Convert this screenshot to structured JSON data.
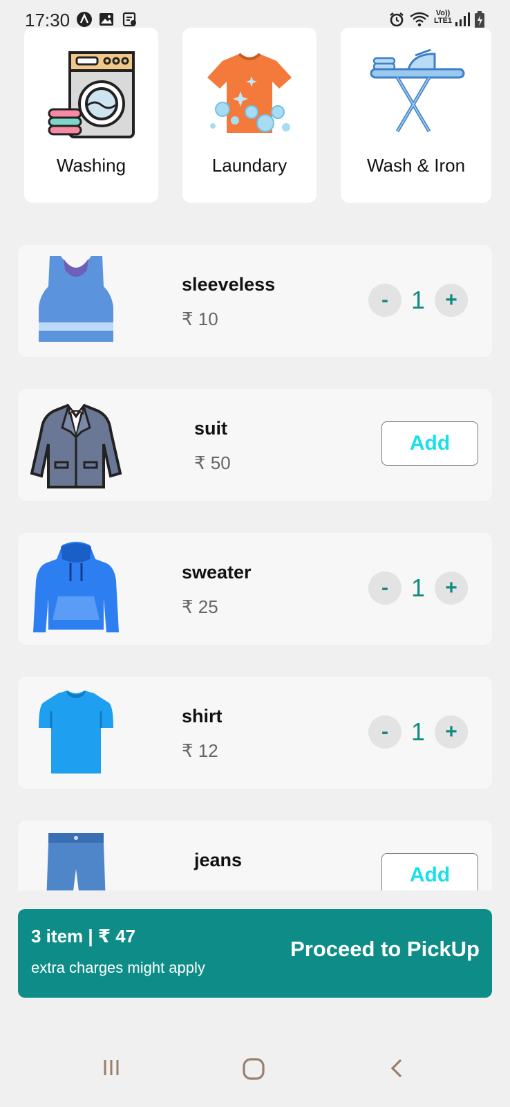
{
  "status_bar": {
    "time": "17:30",
    "left_icons": [
      "a-circle-icon",
      "image-icon",
      "clipboard-icon"
    ],
    "right_icons": [
      "alarm-icon",
      "wifi-icon",
      "volte-icon",
      "signal-icon",
      "battery-icon"
    ],
    "volte_text": "Vo)) LTE1"
  },
  "services": [
    {
      "label": "Washing",
      "icon": "washing-machine-icon"
    },
    {
      "label": "Laundary",
      "icon": "tshirt-bubbles-icon"
    },
    {
      "label": "Wash & Iron",
      "icon": "ironing-board-icon"
    }
  ],
  "items": [
    {
      "name": "sleeveless",
      "price": "₹ 10",
      "quantity": "1",
      "icon": "tank-top-icon",
      "minus": "-",
      "plus": "+"
    },
    {
      "name": "suit",
      "price": "₹ 50",
      "add_label": "Add",
      "icon": "suit-icon"
    },
    {
      "name": "sweater",
      "price": "₹ 25",
      "quantity": "1",
      "icon": "hoodie-icon",
      "minus": "-",
      "plus": "+"
    },
    {
      "name": "shirt",
      "price": "₹ 12",
      "quantity": "1",
      "icon": "tshirt-icon",
      "minus": "-",
      "plus": "+"
    },
    {
      "name": "jeans",
      "add_label": "Add",
      "icon": "jeans-icon"
    }
  ],
  "cart": {
    "summary": "3 item | ₹ 47",
    "note": "extra charges might apply",
    "proceed_label": "Proceed to PickUp"
  },
  "nav_bar": {
    "icons": [
      "recent-apps-icon",
      "home-icon",
      "back-icon"
    ]
  },
  "colors": {
    "accent": "#0e8d88",
    "qty_text": "#108a85",
    "add_text": "#19e0e8",
    "background": "#f0f0f0",
    "card": "#f7f7f7"
  }
}
